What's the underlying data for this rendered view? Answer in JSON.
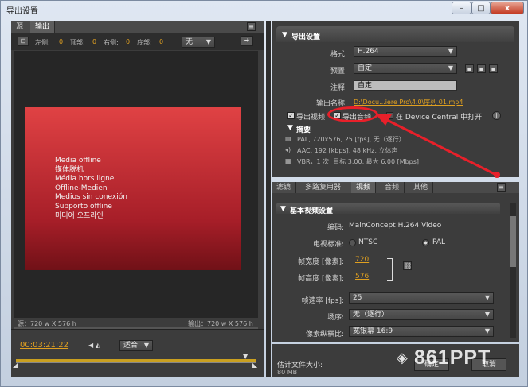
{
  "window": {
    "title": "导出设置",
    "minimize": "–",
    "maximize": "□",
    "close": "x"
  },
  "left": {
    "tabs": [
      {
        "label": "源"
      },
      {
        "label": "输出"
      }
    ],
    "crop": {
      "left_label": "左侧:",
      "left_val": "0",
      "top_label": "顶部:",
      "top_val": "0",
      "right_label": "右侧:",
      "right_val": "0",
      "bottom_label": "底部:",
      "bottom_val": "0",
      "ratio": "无"
    },
    "offline_lines": [
      "Media offline",
      "媒体脱机",
      "Média hors ligne",
      "Offline-Medien",
      "Medios sin conexión",
      "Supporto offline",
      "미디어 오프라인"
    ],
    "source_size": "源：720 w X 576 h",
    "output_size": "输出：720 w X 576 h",
    "timecode": "00:03:21:22",
    "fit": "适合"
  },
  "export": {
    "section_title": "导出设置",
    "format_label": "格式:",
    "format_value": "H.264",
    "preset_label": "预置:",
    "preset_value": "自定",
    "comment_label": "注释:",
    "comment_value": "自定",
    "output_name_label": "输出名称:",
    "output_name_value": "D:\\Docu...iere Pro\\4.0\\序列 01.mp4",
    "export_video": "导出视频",
    "export_audio": "导出音频",
    "device_central": "在 Device Central 中打开",
    "summary_title": "摘要",
    "summary_video": "PAL, 720x576, 25 [fps], 无（逐行）",
    "summary_audio": "AAC, 192 [kbps], 48 kHz, 立体声",
    "summary_vbr": "VBR，1 次, 目标 3.00, 最大 6.00 [Mbps]"
  },
  "tabs2": [
    {
      "label": "滤镜"
    },
    {
      "label": "多路复用器"
    },
    {
      "label": "视频"
    },
    {
      "label": "音频"
    },
    {
      "label": "其他"
    }
  ],
  "video": {
    "section_title": "基本视频设置",
    "codec_label": "编码:",
    "codec_value": "MainConcept H.264 Video",
    "tv_label": "电视标准:",
    "ntsc": "NTSC",
    "pal": "PAL",
    "width_label": "帧宽度 [像素]:",
    "width_value": "720",
    "height_label": "帧高度 [像素]:",
    "height_value": "576",
    "fps_label": "帧速率 [fps]:",
    "fps_value": "25",
    "field_label": "场序:",
    "field_value": "无（逐行）",
    "par_label": "像素纵横比:",
    "par_value": "宽银幕 16:9"
  },
  "footer": {
    "size_label": "估计文件大小:",
    "size_value": "80 MB",
    "watermark": "861PPT",
    "ok": "确定",
    "cancel": "取消"
  },
  "colors": {
    "accent_orange": "#e0a020",
    "annotation_red": "#e8202a"
  }
}
